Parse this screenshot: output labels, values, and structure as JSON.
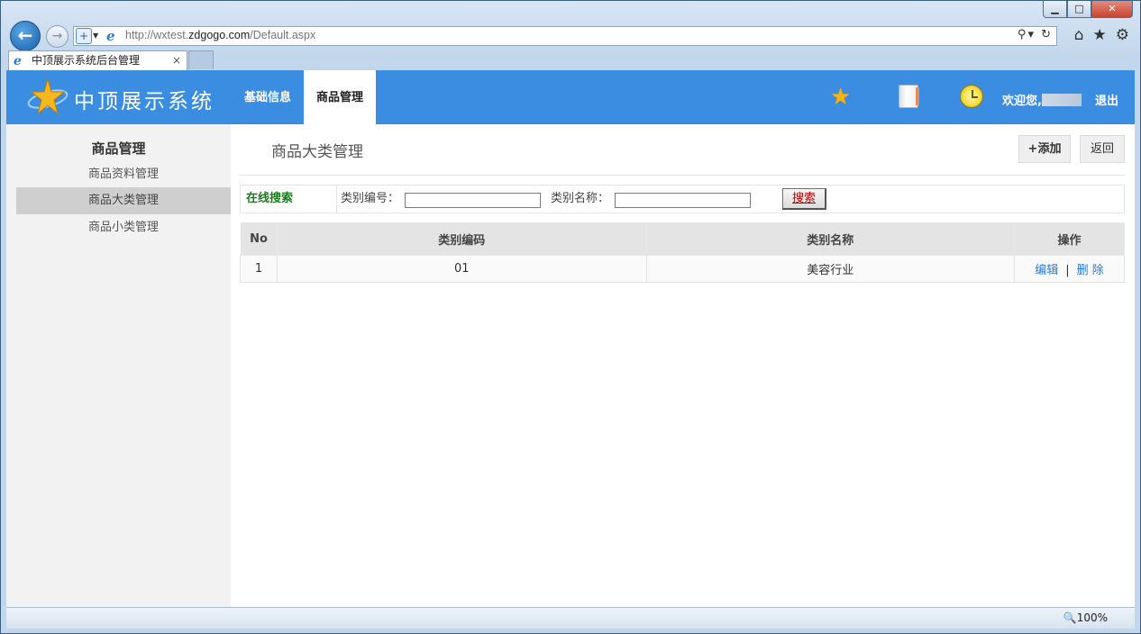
{
  "browser": {
    "url_prefix": "http://wxtest.",
    "url_domain": "zdgogo.com",
    "url_path": "/Default.aspx",
    "tab_title": "中顶展示系统后台管理",
    "tab_close": "×",
    "zoom": "100%",
    "window_controls": {
      "minimize": "▁",
      "maximize": "□",
      "close": "✕"
    },
    "addr_tools": "⚲▾ ↻",
    "toolbar_icons": [
      "home-icon",
      "star-icon",
      "gear-icon"
    ]
  },
  "header": {
    "brand": "中顶展示系统",
    "nav": [
      "基础信息",
      "商品管理"
    ],
    "active_nav": "商品管理",
    "welcome": "欢迎您,",
    "logout": "退出",
    "accent_color": "#3a8de0"
  },
  "sidebar": {
    "title": "商品管理",
    "items": [
      "商品资料管理",
      "商品大类管理",
      "商品小类管理"
    ],
    "active_item": "商品大类管理"
  },
  "main": {
    "title": "商品大类管理",
    "add_button": "+添加",
    "back_button": "返回",
    "search": {
      "label": "在线搜索",
      "code_label": "类别编号：",
      "code_value": "",
      "name_label": "类别名称：",
      "name_value": "",
      "button": "搜索"
    },
    "table": {
      "headers": [
        "No",
        "类别编码",
        "类别名称",
        "操作"
      ],
      "rows": [
        {
          "no": "1",
          "code": "01",
          "name": "美容行业",
          "edit": "编辑",
          "sep": "|",
          "delete": "删 除"
        }
      ]
    }
  }
}
